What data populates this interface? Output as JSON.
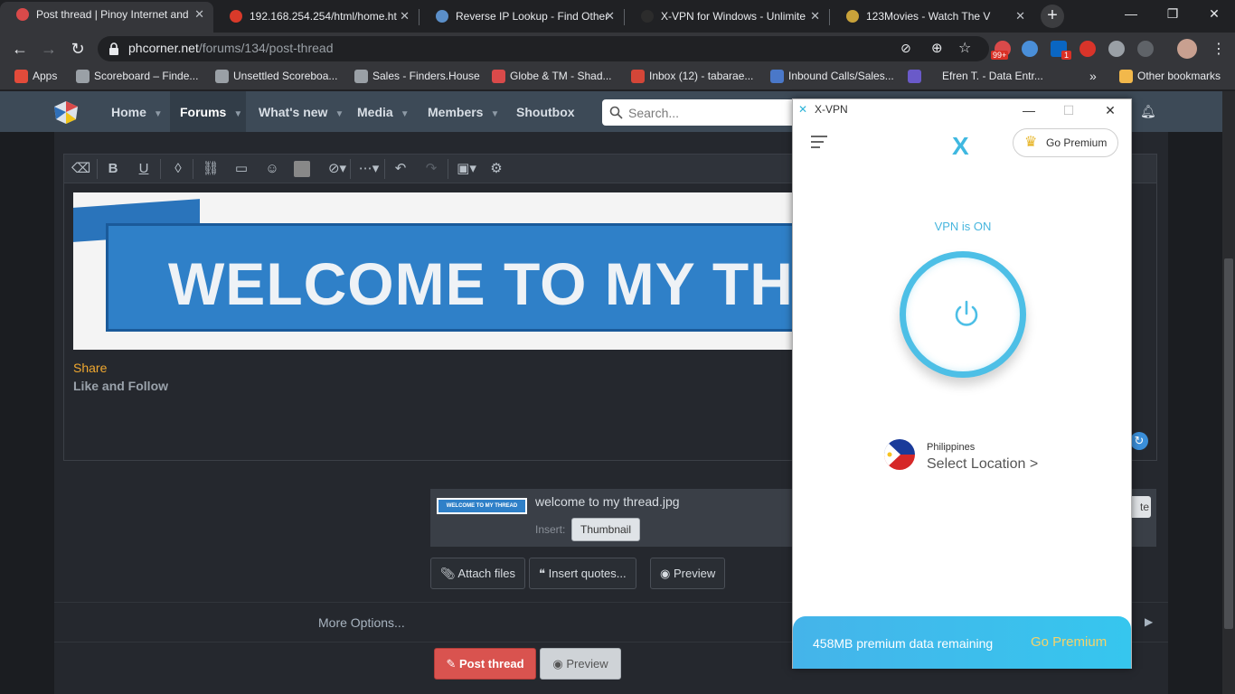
{
  "browser": {
    "tabs": [
      {
        "title": "Post thread | Pinoy Internet and",
        "favicon_color": "#d94a4a"
      },
      {
        "title": "192.168.254.254/html/home.ht",
        "favicon_color": "#d93a2a"
      },
      {
        "title": "Reverse IP Lookup - Find Other",
        "favicon_color": "#5b8fc9"
      },
      {
        "title": "X-VPN for Windows - Unlimite",
        "favicon_color": "#2c2c2c"
      },
      {
        "title": "123Movies - Watch The V",
        "favicon_color": "#c9a23a"
      }
    ],
    "address": {
      "domain": "phcorner.net",
      "path": "/forums/134/post-thread"
    },
    "badges": {
      "mail_count": "99+",
      "linkedin_count": "1"
    },
    "bookmarks": [
      {
        "label": "Apps",
        "color": "#e34b3a"
      },
      {
        "label": "Scoreboard – Finde...",
        "color": "#9aa0a6"
      },
      {
        "label": "Unsettled Scoreboa...",
        "color": "#9aa0a6"
      },
      {
        "label": "Sales - Finders.House",
        "color": "#9aa0a6"
      },
      {
        "label": "Globe & TM - Shad...",
        "color": "#d94a4a"
      },
      {
        "label": "Inbox (12) - tabarae...",
        "color": "#d44638"
      },
      {
        "label": "Inbound Calls/Sales...",
        "color": "#4a78c9"
      },
      {
        "label": "Efren T. - Data Entr...",
        "color": "#6a5ac9"
      }
    ],
    "more_bookmarks": "»",
    "other_bookmarks": "Other bookmarks"
  },
  "site": {
    "nav": [
      {
        "label": "Home",
        "has_caret": true
      },
      {
        "label": "Forums",
        "has_caret": true
      },
      {
        "label": "What's new",
        "has_caret": true
      },
      {
        "label": "Media",
        "has_caret": true
      },
      {
        "label": "Members",
        "has_caret": true
      },
      {
        "label": "Shoutbox",
        "has_caret": false
      }
    ],
    "search_placeholder": "Search..."
  },
  "editor": {
    "banner_text": "WELCOME TO MY THREAD",
    "share_text": "Share",
    "like_follow_text": "Like and Follow"
  },
  "attachment": {
    "thumb_text": "WELCOME TO MY THREAD",
    "filename": "welcome to my thread.jpg",
    "insert_label": "Insert:",
    "thumbnail_button": "Thumbnail",
    "delete_button": "te"
  },
  "actions": {
    "attach_files": "Attach files",
    "insert_quotes": "Insert quotes...",
    "preview": "Preview",
    "more_options": "More Options...",
    "post_thread": "Post thread",
    "preview2": "Preview"
  },
  "vpn": {
    "window_title": "X-VPN",
    "logo": "X",
    "go_premium": "Go Premium",
    "status": "VPN is ON",
    "country": "Philippines",
    "select_location": "Select Location >",
    "data_remaining": "458MB premium data remaining",
    "footer_premium": "Go Premium",
    "accent_color": "#4dbfe6"
  }
}
